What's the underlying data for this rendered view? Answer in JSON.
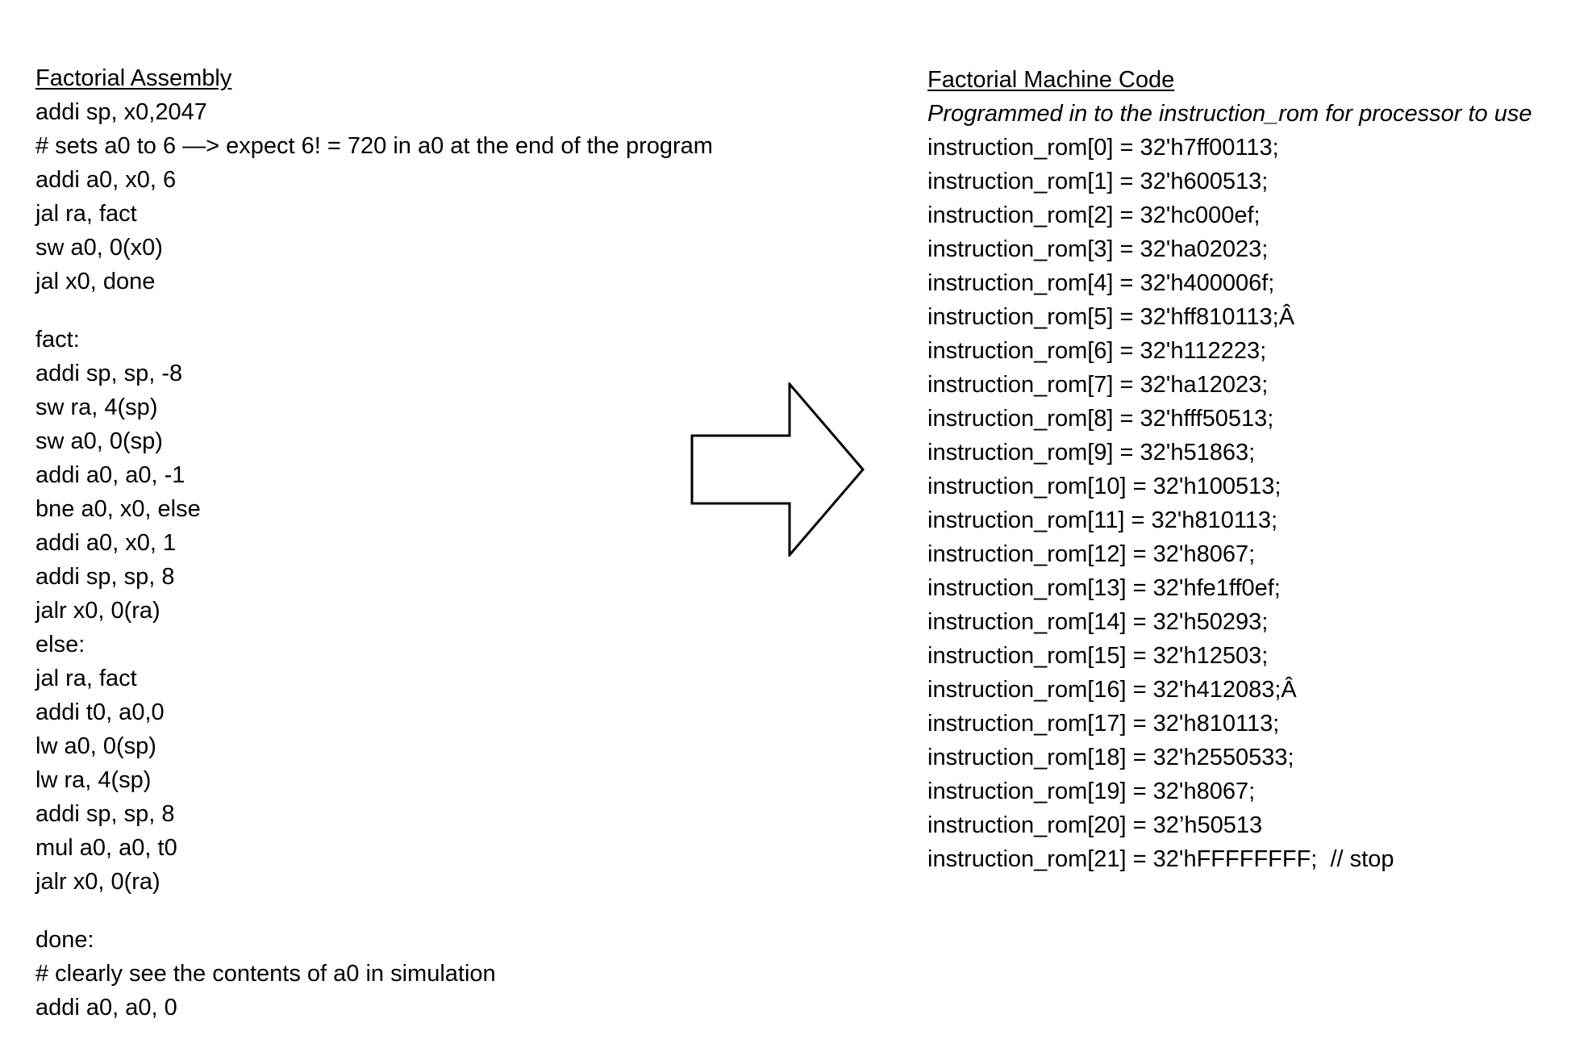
{
  "assembly": {
    "heading": "Factorial Assembly",
    "blocks": [
      [
        "addi sp, x0,2047",
        "# sets a0 to 6 —> expect 6! = 720 in a0 at the end of the program",
        "addi a0, x0, 6",
        "jal ra, fact",
        "sw a0, 0(x0)",
        "jal x0, done"
      ],
      [
        "fact:",
        "addi sp, sp, -8",
        "sw ra, 4(sp)",
        "sw a0, 0(sp)",
        "addi a0, a0, -1",
        "bne a0, x0, else",
        "addi a0, x0, 1",
        "addi sp, sp, 8",
        "jalr x0, 0(ra)",
        "else:",
        "jal ra, fact",
        "addi t0, a0,0",
        "lw a0, 0(sp)",
        "lw ra, 4(sp)",
        "addi sp, sp, 8",
        "mul a0, a0, t0",
        "jalr x0, 0(ra)"
      ],
      [
        "done:",
        "# clearly see the contents of a0 in simulation",
        "addi a0, a0, 0"
      ]
    ]
  },
  "machine_code": {
    "heading": "Factorial Machine Code",
    "subtitle": "Programmed in to the instruction_rom for processor to use",
    "lines": [
      "instruction_rom[0] = 32'h7ff00113;",
      "instruction_rom[1] = 32'h600513;",
      "instruction_rom[2] = 32'hc000ef;",
      "instruction_rom[3] = 32'ha02023;",
      "instruction_rom[4] = 32'h400006f;",
      "instruction_rom[5] = 32'hff810113;Â",
      "instruction_rom[6] = 32'h112223;",
      "instruction_rom[7] = 32'ha12023;",
      "instruction_rom[8] = 32'hfff50513;",
      "instruction_rom[9] = 32'h51863;",
      "instruction_rom[10] = 32'h100513;",
      "instruction_rom[11] = 32'h810113;",
      "instruction_rom[12] = 32'h8067;",
      "instruction_rom[13] = 32'hfe1ff0ef;",
      "instruction_rom[14] = 32'h50293;",
      "instruction_rom[15] = 32'h12503;",
      "instruction_rom[16] = 32'h412083;Â",
      "instruction_rom[17] = 32'h810113;",
      "instruction_rom[18] = 32'h2550533;",
      "instruction_rom[19] = 32'h8067;",
      "instruction_rom[20] = 32’h50513",
      "instruction_rom[21] = 32'hFFFFFFFF;  // stop"
    ]
  },
  "arrow": {
    "icon": "right-arrow-icon",
    "stroke_color": "#000000",
    "fill_color": "#ffffff"
  }
}
